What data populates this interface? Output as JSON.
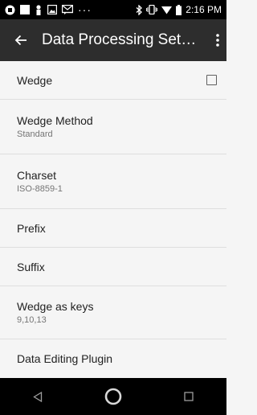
{
  "status_bar": {
    "time": "2:16 PM",
    "left_icons": [
      "notification-icon",
      "square-icon",
      "person-icon",
      "photo-icon",
      "message-icon",
      "more-dots-icon"
    ],
    "right_icons": [
      "bluetooth-icon",
      "vibrate-icon",
      "wifi-icon",
      "battery-icon"
    ],
    "more_dots": "···"
  },
  "app_bar": {
    "title": "Data Processing Set…",
    "back_icon": "arrow-back-icon",
    "menu_icon": "more-vert-icon"
  },
  "settings": [
    {
      "title": "Wedge",
      "summary": "",
      "has_checkbox": true,
      "checked": false
    },
    {
      "title": "Wedge Method",
      "summary": "Standard"
    },
    {
      "title": "Charset",
      "summary": "ISO-8859-1"
    },
    {
      "title": "Prefix",
      "summary": ""
    },
    {
      "title": "Suffix",
      "summary": ""
    },
    {
      "title": "Wedge as keys",
      "summary": "9,10,13"
    },
    {
      "title": "Data Editing Plugin",
      "summary": ""
    }
  ],
  "nav_bar": {
    "buttons": [
      "back-triangle-icon",
      "home-circle-icon",
      "recents-square-icon"
    ]
  },
  "colors": {
    "status_bar": "#000000",
    "app_bar": "#2d2d2d",
    "background": "#f5f5f5",
    "divider": "#dedede",
    "nav_bar": "#000000"
  }
}
